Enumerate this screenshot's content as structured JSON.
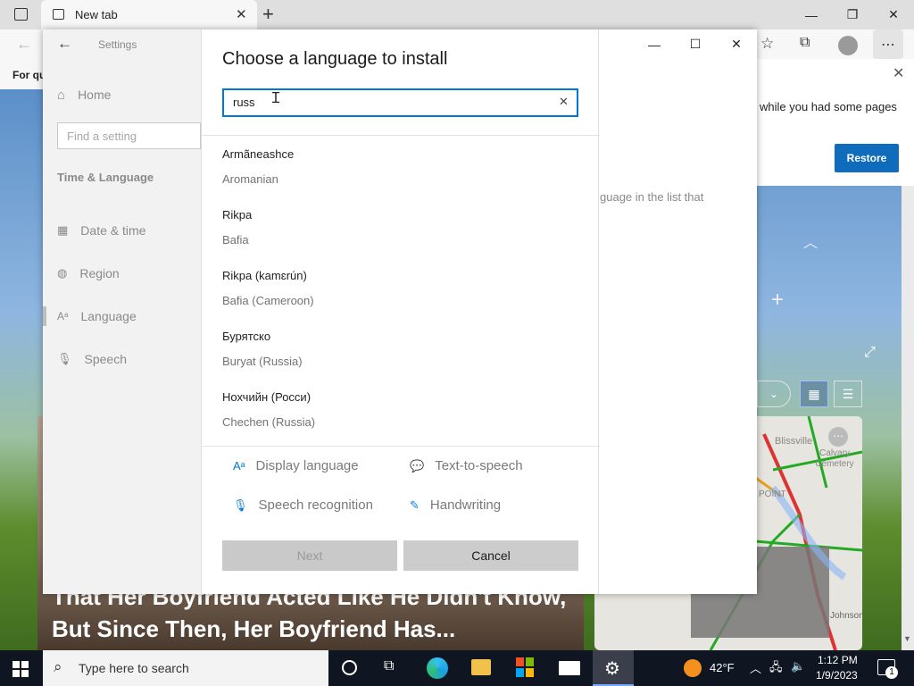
{
  "browser": {
    "tab_title": "New tab",
    "favbar_text": "For qu",
    "restore": {
      "message": "while you had some pages",
      "button": "Restore"
    },
    "news_headline": "That Her Boyfriend Acted Like He Didn't Know, But Since Then, Her Boyfriend Has...",
    "map_labels": [
      "Blissville",
      "Calvary Cemetery",
      "POINT",
      "Johnson"
    ]
  },
  "settings": {
    "title": "Settings",
    "home": "Home",
    "search_placeholder": "Find a setting",
    "section": "Time & Language",
    "nav": [
      "Date & time",
      "Region",
      "Language",
      "Speech"
    ],
    "partial_text": "guage in the list that"
  },
  "dialog": {
    "title": "Choose a language to install",
    "search_value": "russ",
    "languages": [
      {
        "native": "Armãneashce",
        "english": "Aromanian"
      },
      {
        "native": "Rikpa",
        "english": "Bafia"
      },
      {
        "native": "Rikpa (kamɛrún)",
        "english": "Bafia (Cameroon)"
      },
      {
        "native": "Бурятско",
        "english": "Buryat (Russia)"
      },
      {
        "native": "Нохчийн (Росси)",
        "english": "Chechen (Russia)"
      }
    ],
    "features": [
      "Display language",
      "Text-to-speech",
      "Speech recognition",
      "Handwriting"
    ],
    "next": "Next",
    "cancel": "Cancel"
  },
  "taskbar": {
    "search_placeholder": "Type here to search",
    "temperature": "42°F",
    "time": "1:12 PM",
    "date": "1/9/2023",
    "notification_count": "1"
  }
}
